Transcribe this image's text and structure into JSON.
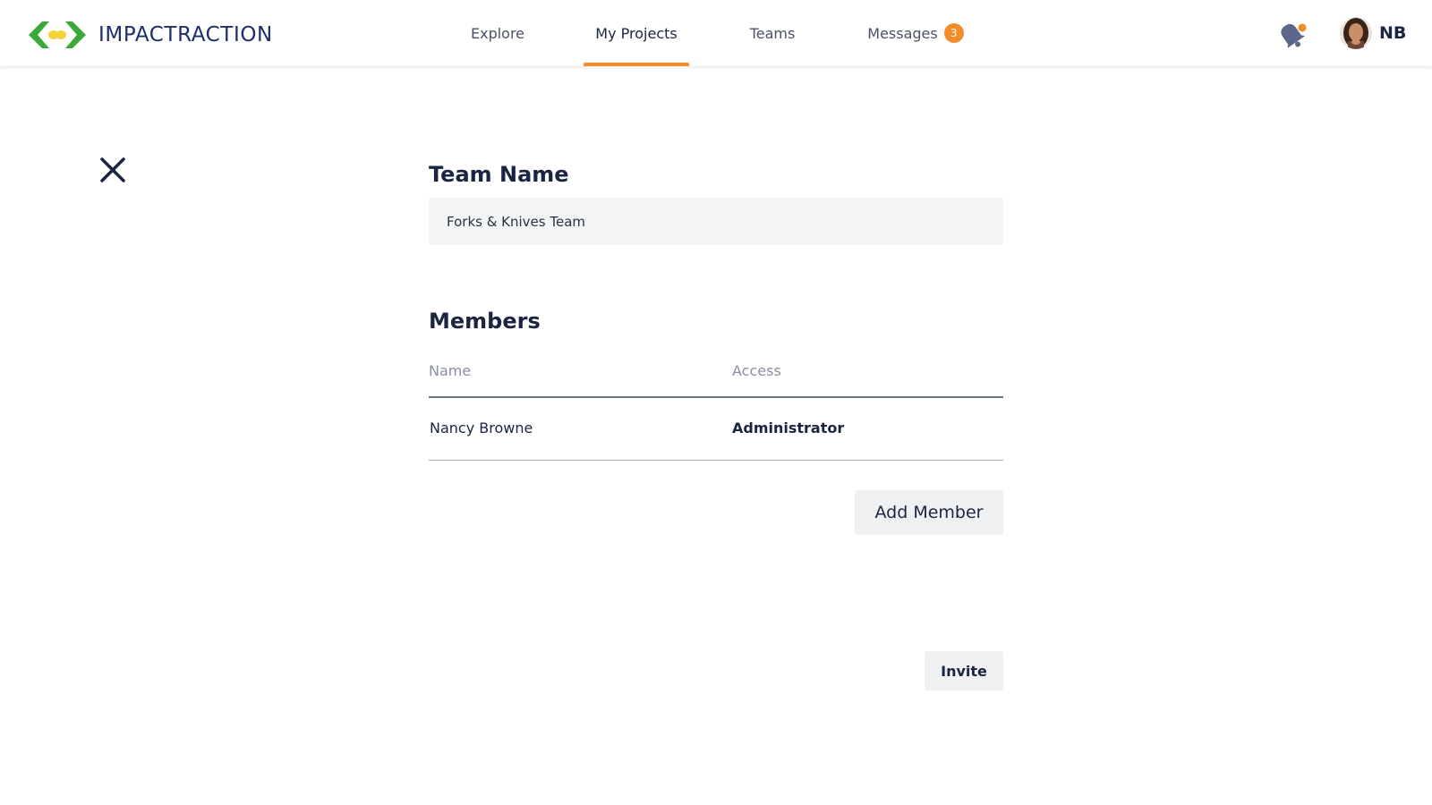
{
  "brand": {
    "name": "IMPACTRACTION"
  },
  "nav": {
    "items": [
      {
        "label": "Explore",
        "active": false
      },
      {
        "label": "My Projects",
        "active": true
      },
      {
        "label": "Teams",
        "active": false
      },
      {
        "label": "Messages",
        "active": false,
        "badge": "3"
      }
    ]
  },
  "header": {
    "notification_icon": "bell-icon",
    "user_initials": "NB"
  },
  "form": {
    "team_name_label": "Team Name",
    "team_name_value": "Forks & Knives Team",
    "members_label": "Members",
    "columns": [
      "Name",
      "Access"
    ],
    "members": [
      {
        "name": "Nancy Browne",
        "access": "Administrator"
      }
    ],
    "add_member_label": "Add Member",
    "invite_label": "Invite"
  },
  "colors": {
    "accent": "#f28c28",
    "text_primary": "#1b2440",
    "brand_green": "#3aa935",
    "brand_yellow": "#f4d23c"
  }
}
